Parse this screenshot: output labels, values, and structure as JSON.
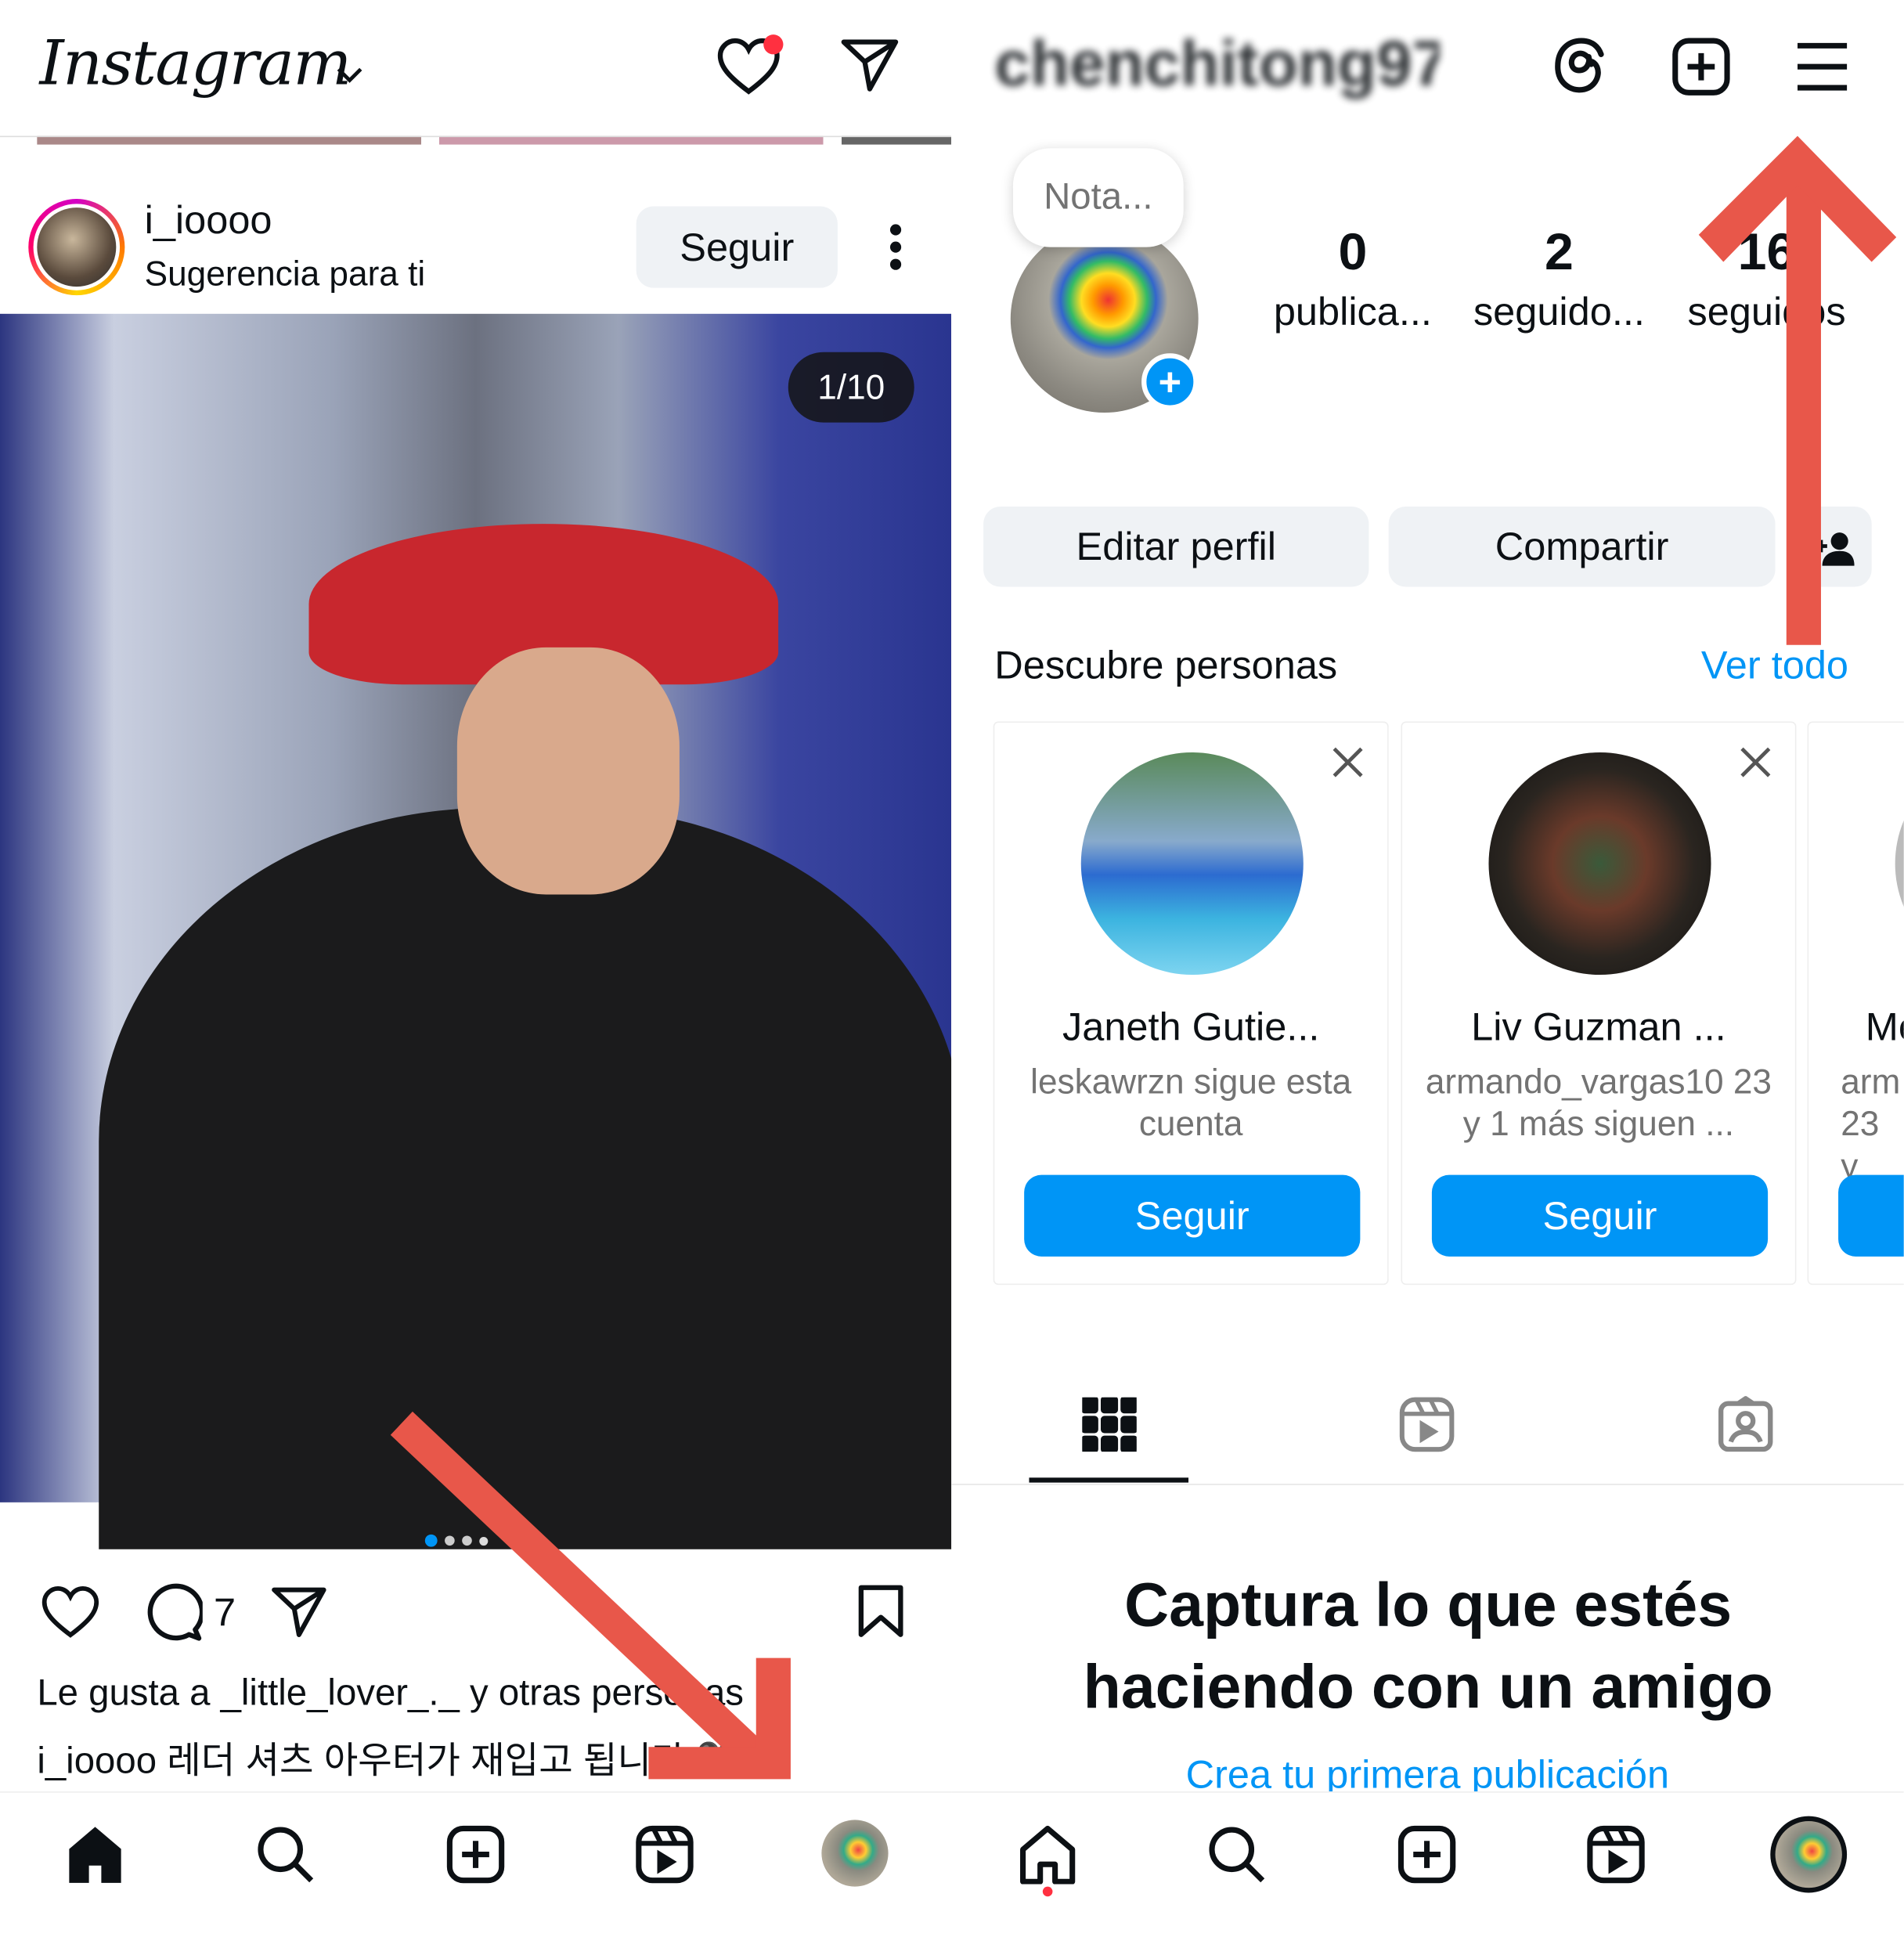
{
  "left": {
    "logo": "Instagram",
    "post": {
      "username": "i_ioooo",
      "subtitle": "Sugerencia para ti",
      "follow_label": "Seguir",
      "counter": "1/10",
      "comment_count": "7",
      "likes_text": "Le gusta a _little_lover_._ y otras personas",
      "caption_user": "i_ioooo",
      "caption_text": "레더 셔츠 아우터가 재입고 됩니다 🖤"
    },
    "nav": [
      "home-icon",
      "search-icon",
      "create-icon",
      "reels-icon",
      "profile-avatar"
    ]
  },
  "right": {
    "username": "chenchitong97",
    "note": "Nota...",
    "stats": [
      {
        "value": "0",
        "label": "publica..."
      },
      {
        "value": "2",
        "label": "seguido..."
      },
      {
        "value": "16",
        "label": "seguidos"
      }
    ],
    "edit_label": "Editar perfil",
    "share_label": "Compartir",
    "discover_title": "Descubre personas",
    "see_all": "Ver todo",
    "suggestions": [
      {
        "name": "Janeth Gutie...",
        "sub": "leskawrzn sigue esta cuenta",
        "follow": "Seguir"
      },
      {
        "name": "Liv Guzman ...",
        "sub": "armando_vargas10 23 y 1 más siguen ...",
        "follow": "Seguir"
      },
      {
        "name": "Me",
        "sub": "arm 23 y",
        "follow": ""
      }
    ],
    "empty_title": "Captura lo que estés haciendo con un amigo",
    "empty_link": "Crea tu primera publicación"
  },
  "colors": {
    "accent": "#0095f6",
    "arrow": "#e8574a",
    "notification": "#ff3040"
  }
}
